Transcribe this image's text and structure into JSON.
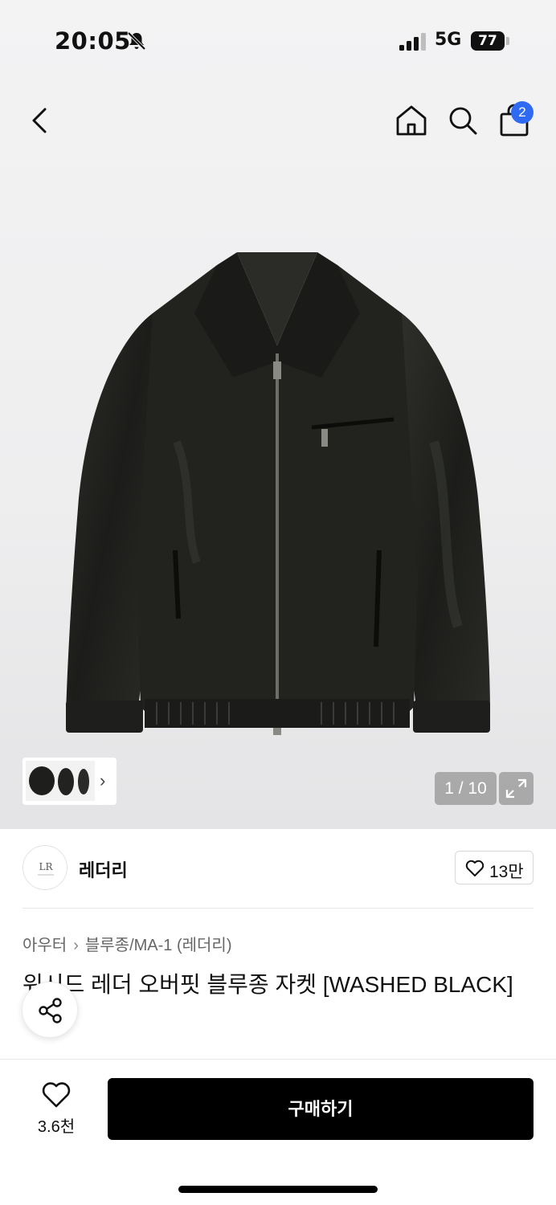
{
  "status_bar": {
    "time": "20:05",
    "network": "5G",
    "battery": "77"
  },
  "header": {
    "cart_badge": "2"
  },
  "gallery": {
    "counter": "1 / 10"
  },
  "brand": {
    "name": "레더리",
    "likes": "13만"
  },
  "breadcrumb": {
    "items": [
      "아우터",
      "블루종/MA-1 (레더리)"
    ]
  },
  "product": {
    "title": "워시드 레더 오버핏 블루종 자켓 [WASHED BLACK]"
  },
  "footer": {
    "wish_count": "3.6천",
    "buy_label": "구매하기"
  },
  "colors": {
    "badge": "#2f6bf2",
    "buy_button": "#000000",
    "hero_bg": "#efeff0"
  },
  "icons": [
    "bell-off-icon",
    "signal-icon",
    "back-icon",
    "home-icon",
    "search-icon",
    "cart-icon",
    "chevron-right-icon",
    "expand-icon",
    "heart-icon",
    "share-icon"
  ]
}
